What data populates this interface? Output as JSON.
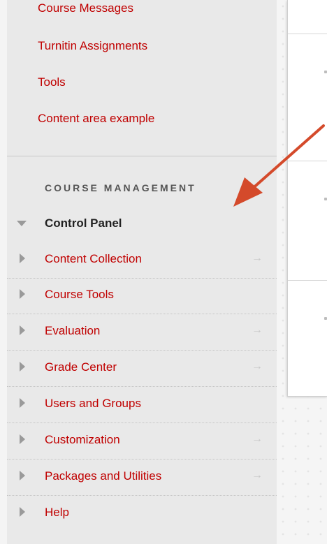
{
  "course_menu": {
    "items": [
      {
        "label": "Course Messages"
      },
      {
        "label": "Turnitin Assignments"
      },
      {
        "label": "Tools"
      },
      {
        "label": "Content area example"
      }
    ]
  },
  "course_management": {
    "title": "COURSE MANAGEMENT",
    "control_panel": {
      "label": "Control Panel",
      "items": [
        {
          "label": "Content Collection",
          "has_arrow": true
        },
        {
          "label": "Course Tools",
          "has_arrow": false
        },
        {
          "label": "Evaluation",
          "has_arrow": true
        },
        {
          "label": "Grade Center",
          "has_arrow": true
        },
        {
          "label": "Users and Groups",
          "has_arrow": false
        },
        {
          "label": "Customization",
          "has_arrow": true
        },
        {
          "label": "Packages and Utilities",
          "has_arrow": true
        },
        {
          "label": "Help",
          "has_arrow": false
        }
      ]
    },
    "arrow_glyph": "→"
  },
  "colors": {
    "link": "#c00000",
    "annotation_arrow": "#d44a2b",
    "sidebar_bg": "#e9e9e9"
  }
}
